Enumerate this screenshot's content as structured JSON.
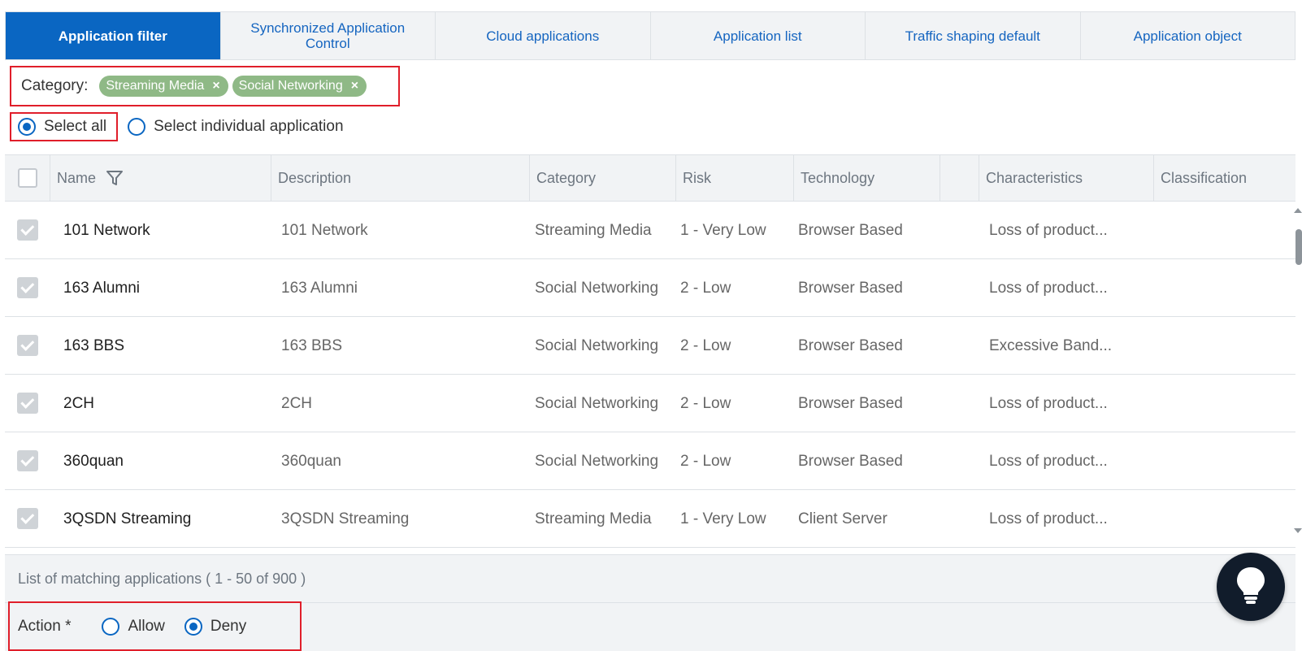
{
  "tabs": [
    {
      "label": "Application filter",
      "active": true
    },
    {
      "label": "Synchronized Application Control",
      "active": false
    },
    {
      "label": "Cloud applications",
      "active": false
    },
    {
      "label": "Application list",
      "active": false
    },
    {
      "label": "Traffic shaping default",
      "active": false
    },
    {
      "label": "Application object",
      "active": false
    }
  ],
  "category": {
    "label": "Category:",
    "chips": [
      "Streaming Media",
      "Social Networking"
    ],
    "remove_glyph": "×"
  },
  "selection": {
    "select_all": "Select all",
    "select_individual": "Select individual application",
    "selected": "select_all"
  },
  "table": {
    "columns": [
      "Name",
      "Description",
      "Category",
      "Risk",
      "Technology",
      "",
      "Characteristics",
      "Classification"
    ],
    "rows": [
      {
        "name": "101 Network",
        "description": "101 Network",
        "category": "Streaming Media",
        "risk": "1 - Very Low",
        "technology": "Browser Based",
        "characteristics": "Loss of product...",
        "classification": ""
      },
      {
        "name": "163 Alumni",
        "description": "163 Alumni",
        "category": "Social Networking",
        "risk": "2 - Low",
        "technology": "Browser Based",
        "characteristics": "Loss of product...",
        "classification": ""
      },
      {
        "name": "163 BBS",
        "description": "163 BBS",
        "category": "Social Networking",
        "risk": "2 - Low",
        "technology": "Browser Based",
        "characteristics": "Excessive Band...",
        "classification": ""
      },
      {
        "name": "2CH",
        "description": "2CH",
        "category": "Social Networking",
        "risk": "2 - Low",
        "technology": "Browser Based",
        "characteristics": "Loss of product...",
        "classification": ""
      },
      {
        "name": "360quan",
        "description": "360quan",
        "category": "Social Networking",
        "risk": "2 - Low",
        "technology": "Browser Based",
        "characteristics": "Loss of product...",
        "classification": ""
      },
      {
        "name": "3QSDN Streaming",
        "description": "3QSDN Streaming",
        "category": "Streaming Media",
        "risk": "1 - Very Low",
        "technology": "Client Server",
        "characteristics": "Loss of product...",
        "classification": ""
      }
    ]
  },
  "list_footer": "List of matching applications ( 1 - 50 of 900 )",
  "action": {
    "label": "Action *",
    "options": [
      "Allow",
      "Deny"
    ],
    "selected": "Deny"
  },
  "colors": {
    "accent": "#0a66c2",
    "chip": "#8fb986",
    "highlight": "#e01e2a"
  },
  "icons": {
    "filter": "filter-funnel-icon",
    "help": "lightbulb-icon"
  }
}
